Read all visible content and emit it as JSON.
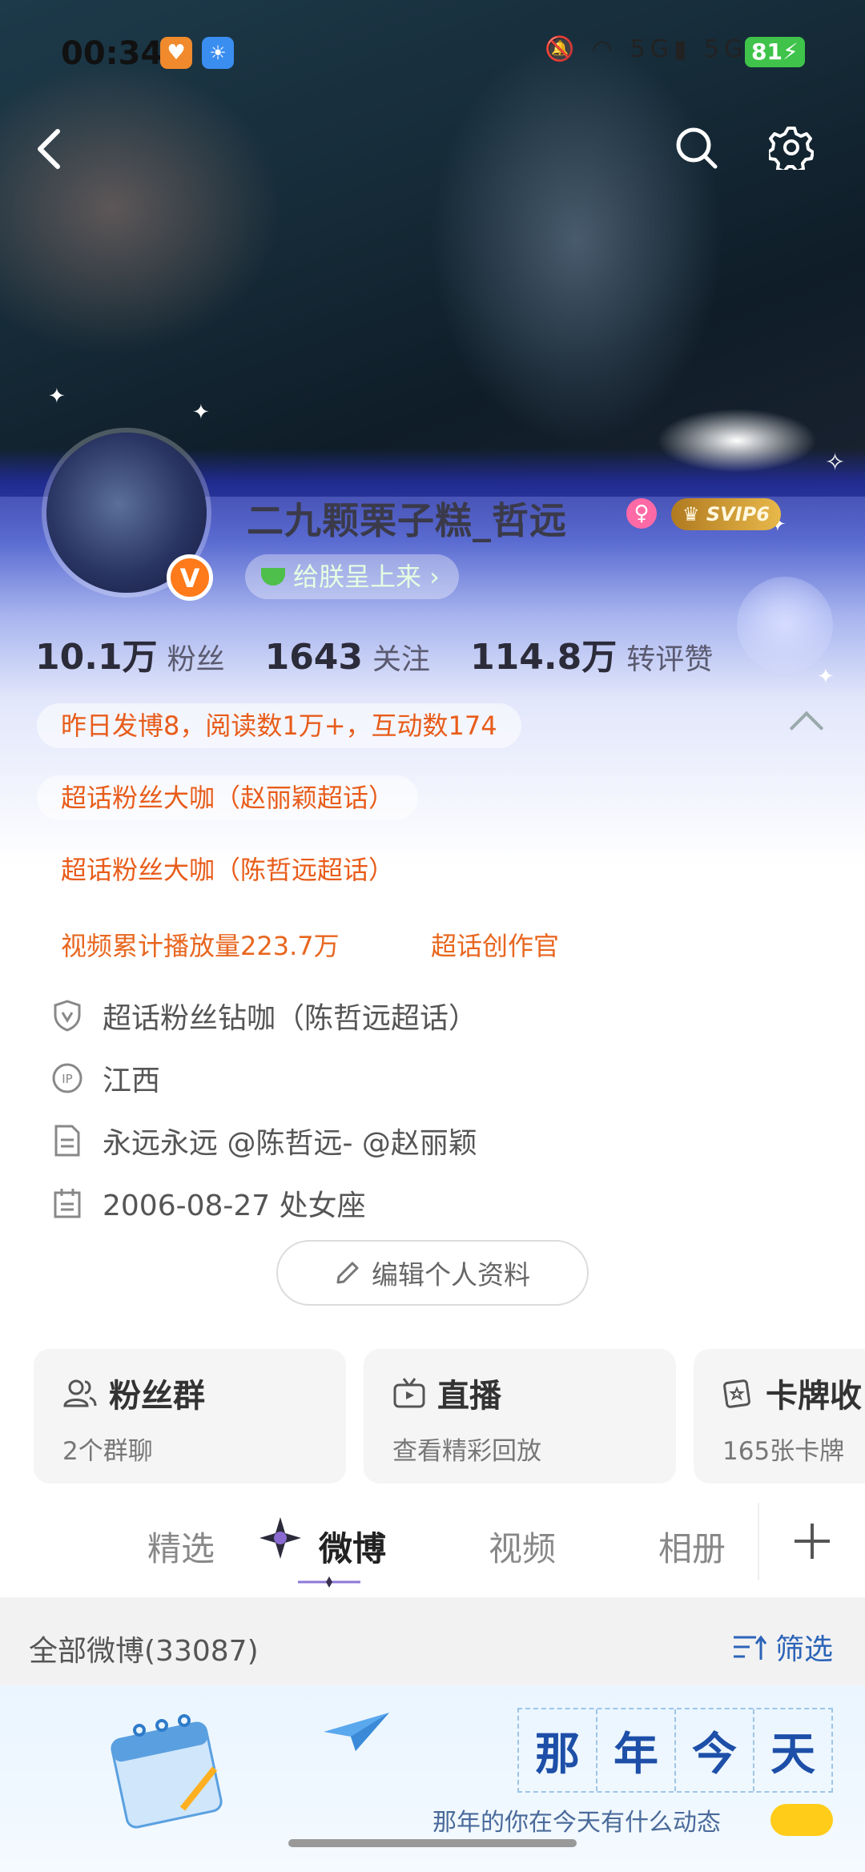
{
  "status_bar": {
    "time": "00:34",
    "battery": "81"
  },
  "profile": {
    "username": "二九颗栗子糕_哲远",
    "verify_mark": "V",
    "svip": "SVIP6",
    "gift_button": "给朕呈上来 ›",
    "stats": [
      {
        "value": "10.1万",
        "label": "粉丝"
      },
      {
        "value": "1643",
        "label": "关注"
      },
      {
        "value": "114.8万",
        "label": "转评赞"
      }
    ]
  },
  "tags": {
    "yesterday": "昨日发博8，阅读数1万+，互动数174",
    "fan_tag_1": "超话粉丝大咖（赵丽颖超话）",
    "fan_tag_2": "超话粉丝大咖（陈哲远超话）",
    "video_plays": "视频累计播放量223.7万",
    "creator": "超话创作官"
  },
  "info": {
    "diamond": "超话粉丝钻咖（陈哲远超话）",
    "ip": "江西",
    "bio": "永远永远 @陈哲远- @赵丽颖",
    "birthday": "2006-08-27 处女座"
  },
  "edit_profile": "编辑个人资料",
  "cards": [
    {
      "title": "粉丝群",
      "sub": "2个群聊"
    },
    {
      "title": "直播",
      "sub": "查看精彩回放"
    },
    {
      "title": "卡牌收",
      "sub": "165张卡牌"
    }
  ],
  "tabs": [
    "精选",
    "微博",
    "视频",
    "相册"
  ],
  "feed": {
    "all_label": "全部微博(33087)",
    "filter_label": "筛选"
  },
  "banner": {
    "chars": [
      "那",
      "年",
      "今",
      "天"
    ],
    "sub": "那年的你在今天有什么动态"
  }
}
